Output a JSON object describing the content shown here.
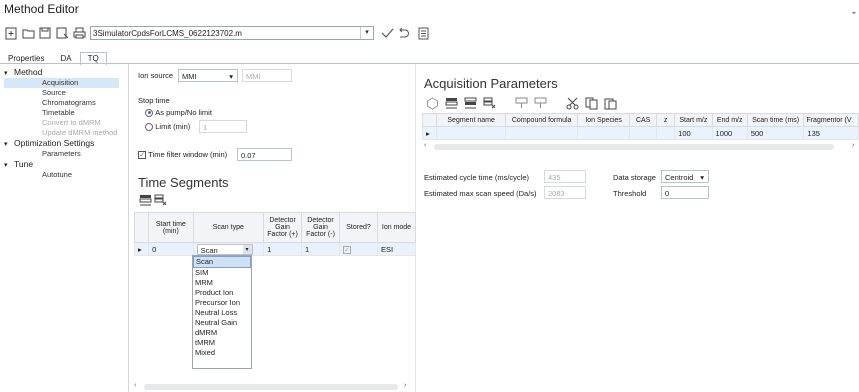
{
  "window": {
    "title": "Method Editor"
  },
  "toolbar": {
    "file_name": "3SimulatorCpdsForLCMS_0622123702.m"
  },
  "tabs": [
    {
      "label": "Properties"
    },
    {
      "label": "DA"
    },
    {
      "label": "TQ"
    }
  ],
  "tree": {
    "method": {
      "label": "Method",
      "items": [
        "Acquisition",
        "Source",
        "Chromatograms",
        "Timetable",
        "Convert to dMRM",
        "Update dMRM method"
      ]
    },
    "optimization": {
      "label": "Optimization Settings",
      "items": [
        "Parameters"
      ]
    },
    "tune": {
      "label": "Tune",
      "items": [
        "Autotune"
      ]
    }
  },
  "ion_source": {
    "label": "Ion source",
    "value": "MMI",
    "secondary": "MMI"
  },
  "stop_time": {
    "label": "Stop time",
    "option1": "As pump/No limit",
    "option2": "Limit (min)",
    "limit_value": "1"
  },
  "time_filter": {
    "label": "Time filter window (min)",
    "value": "0.07",
    "checked": true
  },
  "time_segments": {
    "title": "Time Segments",
    "headers": [
      "Start time (min)",
      "Scan type",
      "Detector Gain Factor (+)",
      "Detector Gain Factor (-)",
      "Stored?",
      "Ion mode"
    ],
    "row": {
      "start": "0",
      "scan_type": "Scan",
      "gain_pos": "1",
      "gain_neg": "1",
      "ion_mode": "ESI"
    },
    "scan_options": [
      "Scan",
      "SIM",
      "MRM",
      "Product Ion",
      "Precursor Ion",
      "Neutral Loss",
      "Neutral Gain",
      "dMRM",
      "tMRM",
      "Mixed"
    ]
  },
  "acquisition": {
    "title": "Acquisition Parameters",
    "headers": [
      "Segment name",
      "Compound formula",
      "Ion Species",
      "CAS",
      "z",
      "Start m/z",
      "End m/z",
      "Scan time (ms)",
      "Fragmentor (V"
    ],
    "row": {
      "start_mz": "100",
      "end_mz": "1000",
      "scan_time": "500",
      "fragmentor": "135"
    }
  },
  "estimates": {
    "cycle_label": "Estimated cycle time (ms/cycle)",
    "cycle_value": "435",
    "speed_label": "Estimated max scan speed (Da/s)",
    "speed_value": "2083",
    "storage_label": "Data storage",
    "storage_value": "Centroid",
    "threshold_label": "Threshold",
    "threshold_value": "0"
  },
  "colors": {
    "accent": "#2a6ed6",
    "selection": "#d6e7f7",
    "border": "#b6c3d6"
  }
}
